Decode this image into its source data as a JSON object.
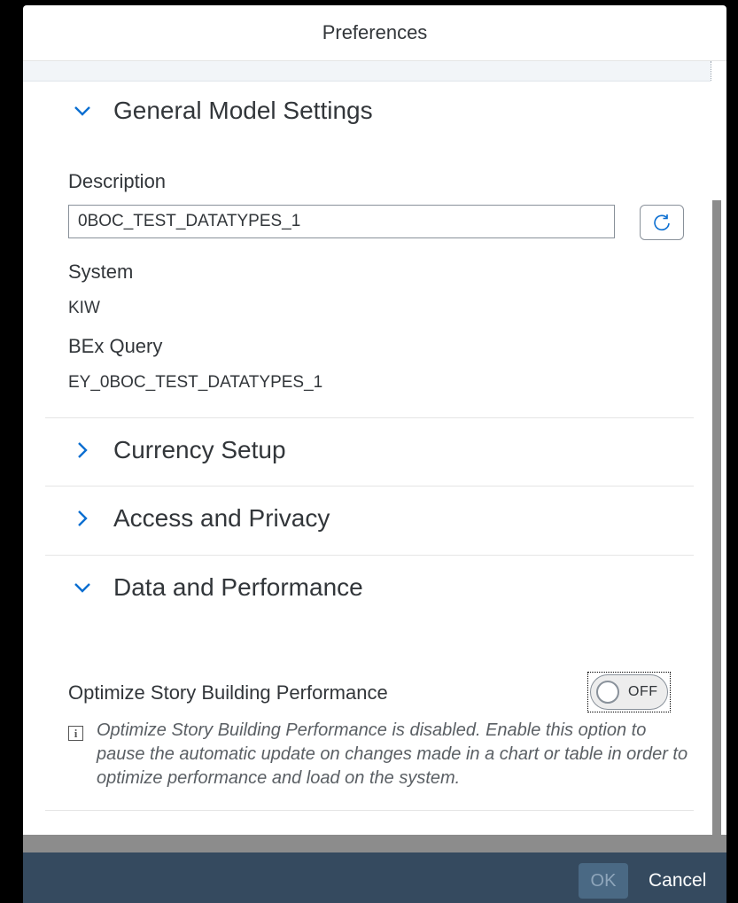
{
  "dialog": {
    "title": "Preferences"
  },
  "sections": {
    "general": {
      "title": "General Model Settings",
      "expanded": true,
      "description_label": "Description",
      "description_value": "0BOC_TEST_DATATYPES_1",
      "system_label": "System",
      "system_value": "KIW",
      "query_label": "BEx Query",
      "query_value": "EY_0BOC_TEST_DATATYPES_1"
    },
    "currency": {
      "title": "Currency Setup",
      "expanded": false
    },
    "access": {
      "title": "Access and Privacy",
      "expanded": false
    },
    "performance": {
      "title": "Data and Performance",
      "expanded": true,
      "optimize_label": "Optimize Story Building Performance",
      "toggle_state": "OFF",
      "info_text": "Optimize Story Building Performance is disabled. Enable this option to pause the automatic update on changes made in a chart or table in order to optimize performance and load on the system."
    }
  },
  "footer": {
    "ok_label": "OK",
    "cancel_label": "Cancel"
  },
  "colors": {
    "footer_bg": "#354a5f",
    "ok_bg": "#4a6984",
    "chevron": "#0a6ed1"
  },
  "icons": {
    "expand": "chevron-down-icon",
    "collapse": "chevron-right-icon",
    "refresh": "refresh-icon",
    "info": "info-icon"
  }
}
